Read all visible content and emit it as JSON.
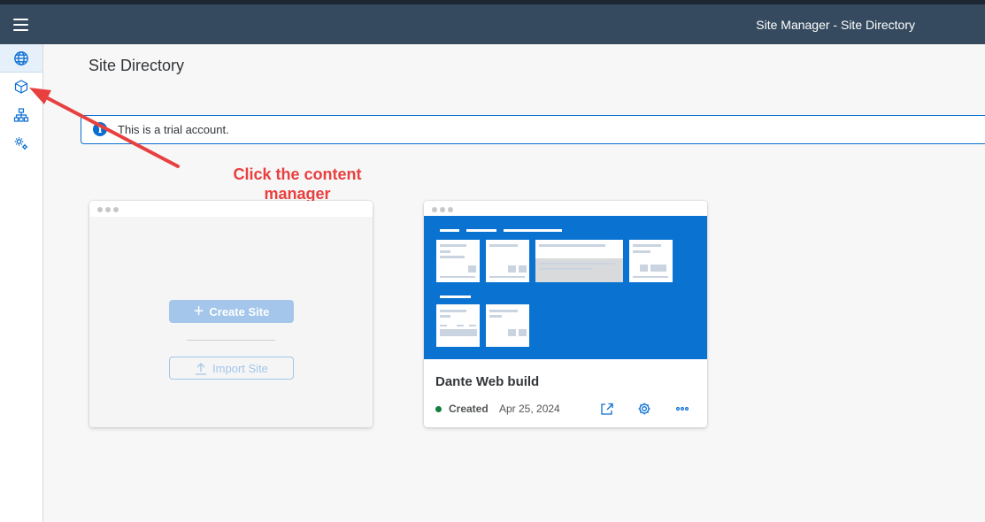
{
  "shell": {
    "title": "Site Manager - Site Directory",
    "menu_icon": "hamburger-menu-icon"
  },
  "sidenav": {
    "items": [
      {
        "name": "site-directory",
        "icon": "globe-icon",
        "selected": true
      },
      {
        "name": "content-manager",
        "icon": "cube-icon",
        "selected": false
      },
      {
        "name": "site-hierarchy",
        "icon": "hierarchy-icon",
        "selected": false
      },
      {
        "name": "settings",
        "icon": "gears-icon",
        "selected": false
      }
    ]
  },
  "page": {
    "title": "Site Directory"
  },
  "message": {
    "text": "This is a trial account.",
    "icon": "info-icon",
    "icon_glyph": "i"
  },
  "annotation": {
    "text": "Click the content manager",
    "color": "#e8403f"
  },
  "create_card": {
    "create_label": "Create Site",
    "import_label": "Import Site"
  },
  "sites": [
    {
      "name": "Dante Web build",
      "status": "Created",
      "date": "Apr 25, 2024",
      "status_color": "#107e3e"
    }
  ],
  "colors": {
    "shellbar": "#354a5f",
    "accent": "#0a6ed1",
    "preview": "#0a72d1"
  }
}
